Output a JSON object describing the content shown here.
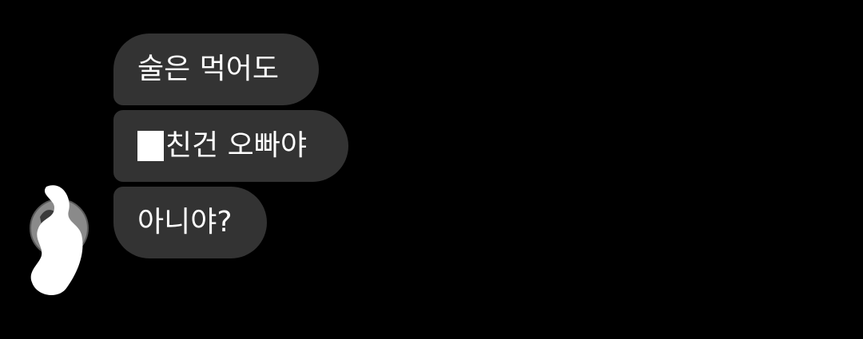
{
  "conversation": {
    "messages": [
      {
        "text": "술은 먹어도"
      },
      {
        "redacted": true,
        "text": "친건 오빠야"
      },
      {
        "text": "아니야?"
      }
    ]
  },
  "avatar": {
    "icon": "redacted-avatar-icon"
  },
  "colors": {
    "background": "#000000",
    "bubble": "#333333",
    "text": "#ffffff"
  }
}
